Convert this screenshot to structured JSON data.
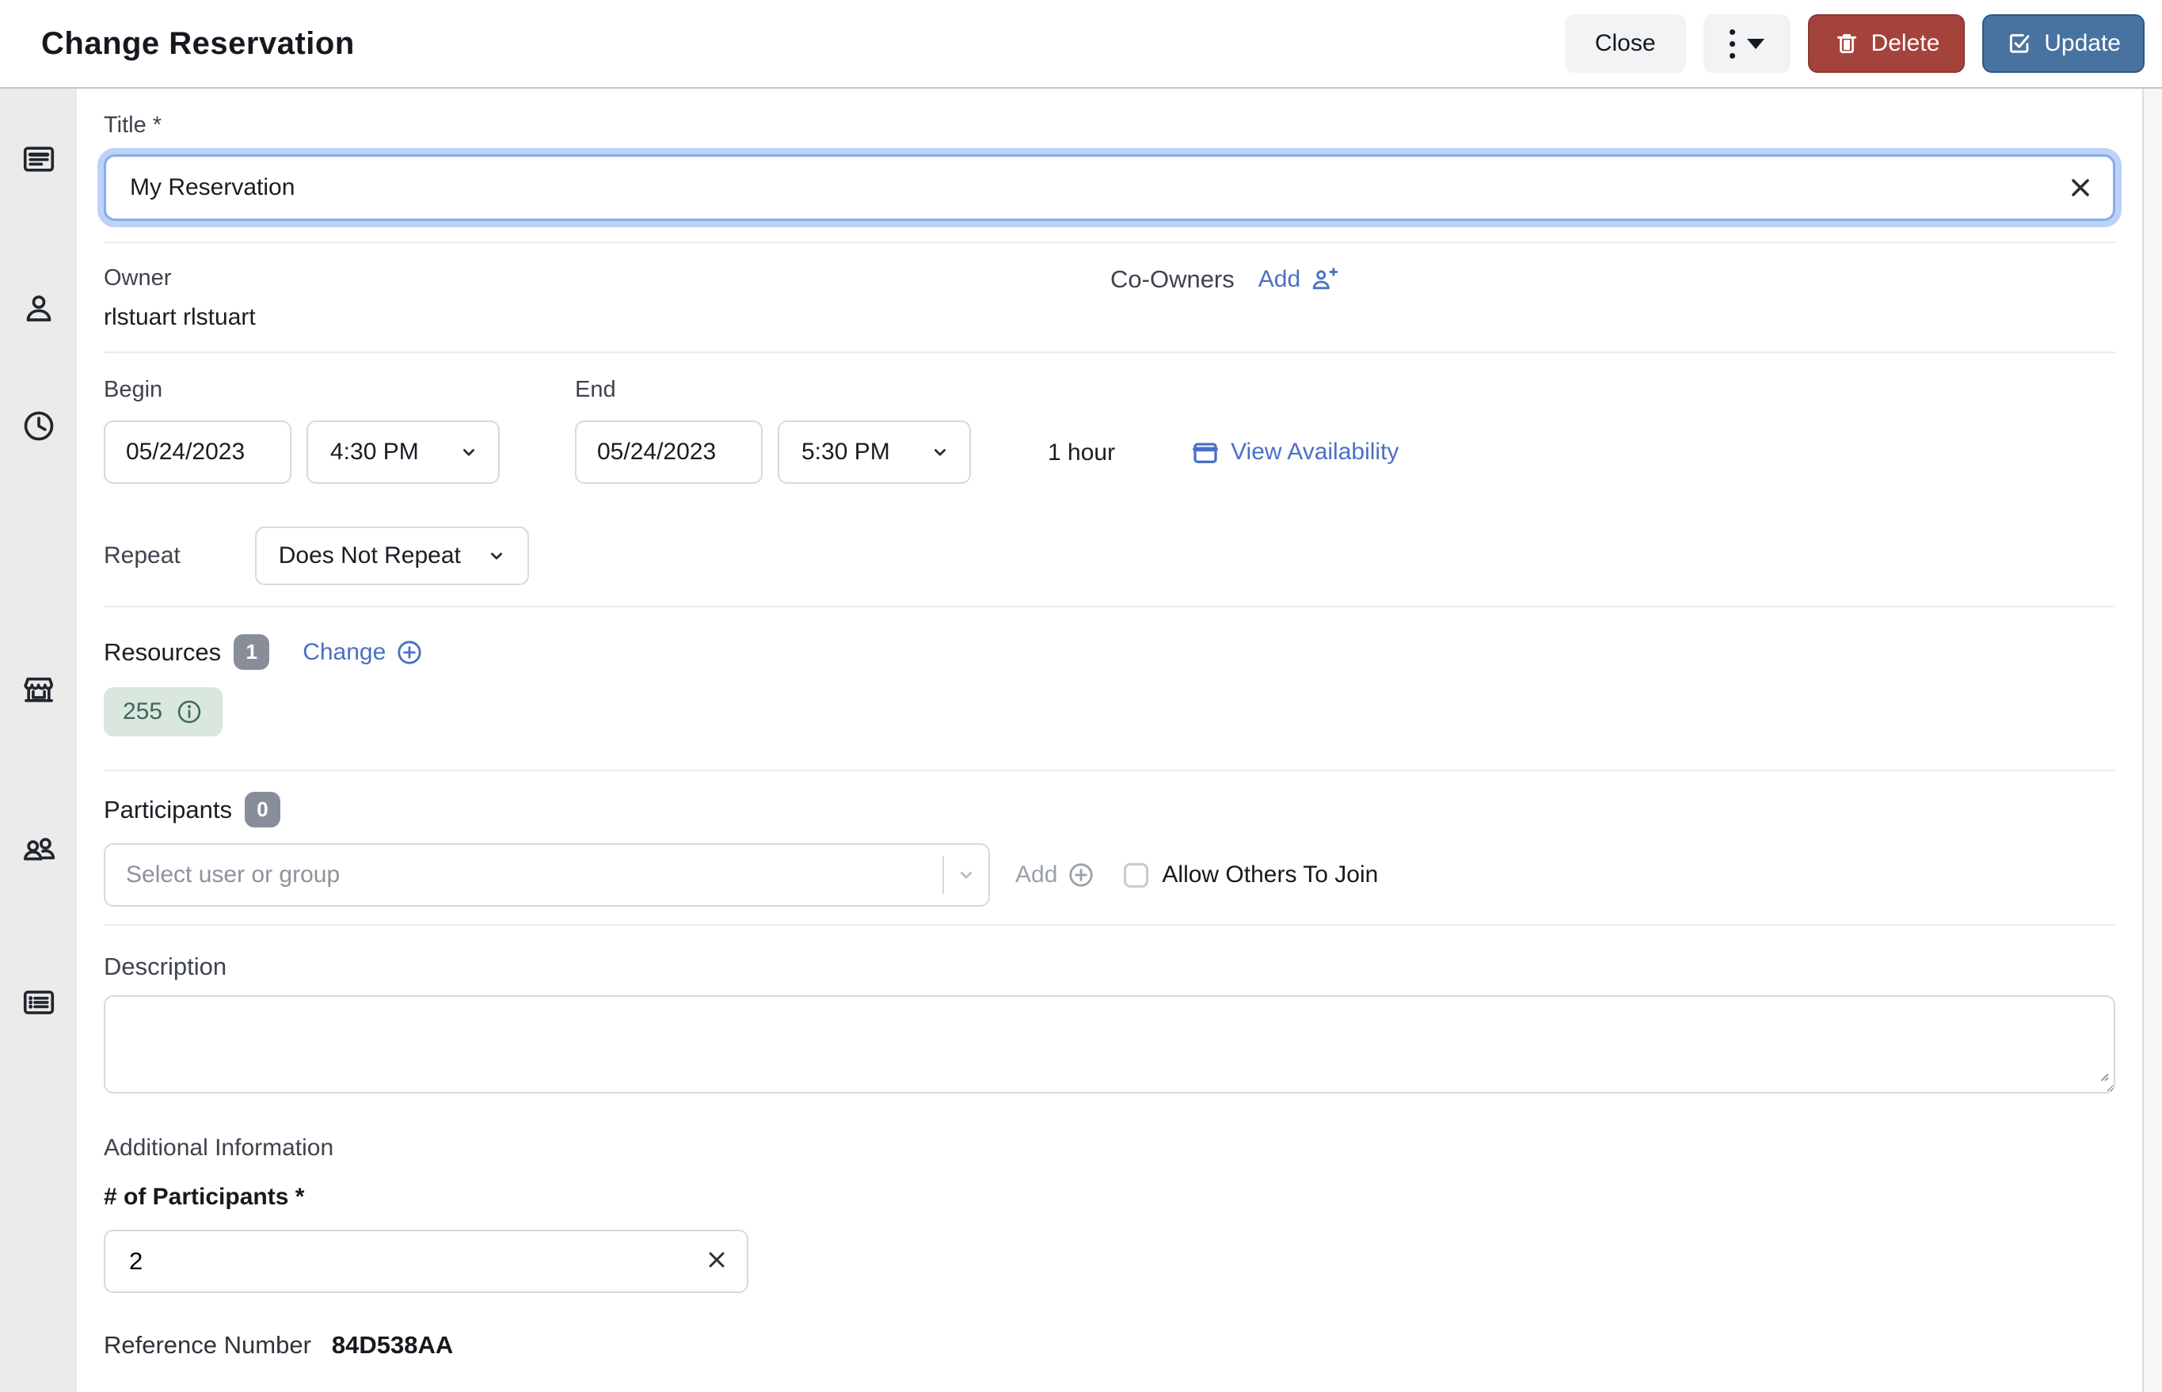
{
  "header": {
    "title": "Change Reservation",
    "close_label": "Close",
    "delete_label": "Delete",
    "update_label": "Update"
  },
  "sidebar": {
    "icons": [
      "note-icon",
      "person-icon",
      "clock-icon",
      "storefront-icon",
      "people-icon",
      "list-icon"
    ]
  },
  "form": {
    "title": {
      "label": "Title *",
      "value": "My Reservation"
    },
    "owner": {
      "label": "Owner",
      "value": "rlstuart rlstuart"
    },
    "co_owners": {
      "label": "Co-Owners",
      "add_label": "Add"
    },
    "schedule": {
      "begin_label": "Begin",
      "begin_date": "05/24/2023",
      "begin_time": "4:30 PM",
      "end_label": "End",
      "end_date": "05/24/2023",
      "end_time": "5:30 PM",
      "duration": "1 hour",
      "view_availability_label": "View Availability"
    },
    "repeat": {
      "label": "Repeat",
      "value": "Does Not Repeat"
    },
    "resources": {
      "label": "Resources",
      "count": "1",
      "change_label": "Change",
      "chips": [
        {
          "label": "255"
        }
      ]
    },
    "participants": {
      "label": "Participants",
      "count": "0",
      "placeholder": "Select user or group",
      "add_label": "Add",
      "allow_join_label": "Allow Others To Join"
    },
    "description": {
      "label": "Description",
      "value": ""
    },
    "additional": {
      "heading": "Additional Information",
      "num_label": "# of Participants *",
      "num_value": "2"
    },
    "reference": {
      "label": "Reference Number",
      "value": "84D538AA"
    }
  },
  "colors": {
    "text": "#1a1e26",
    "label": "#3e434d",
    "link_blue": "#4a70c4",
    "focus_border": "#86abef",
    "focus_ring": "#bcd2f7",
    "delete_bg": "#a4423c",
    "delete_border": "#8d3831",
    "update_bg": "#48729f",
    "update_border": "#2f5a84",
    "neutral_btn_bg": "#f1f3f4",
    "chip_bg": "#d9e7de",
    "chip_text": "#3f685b",
    "badge_bg": "#878e99",
    "sidebar_bg": "#ebebeb",
    "divider": "#ececec",
    "header_border": "#c5c5c5",
    "input_border": "#d9d9d9",
    "placeholder": "#8d939c",
    "muted": "#9ba1a9"
  }
}
